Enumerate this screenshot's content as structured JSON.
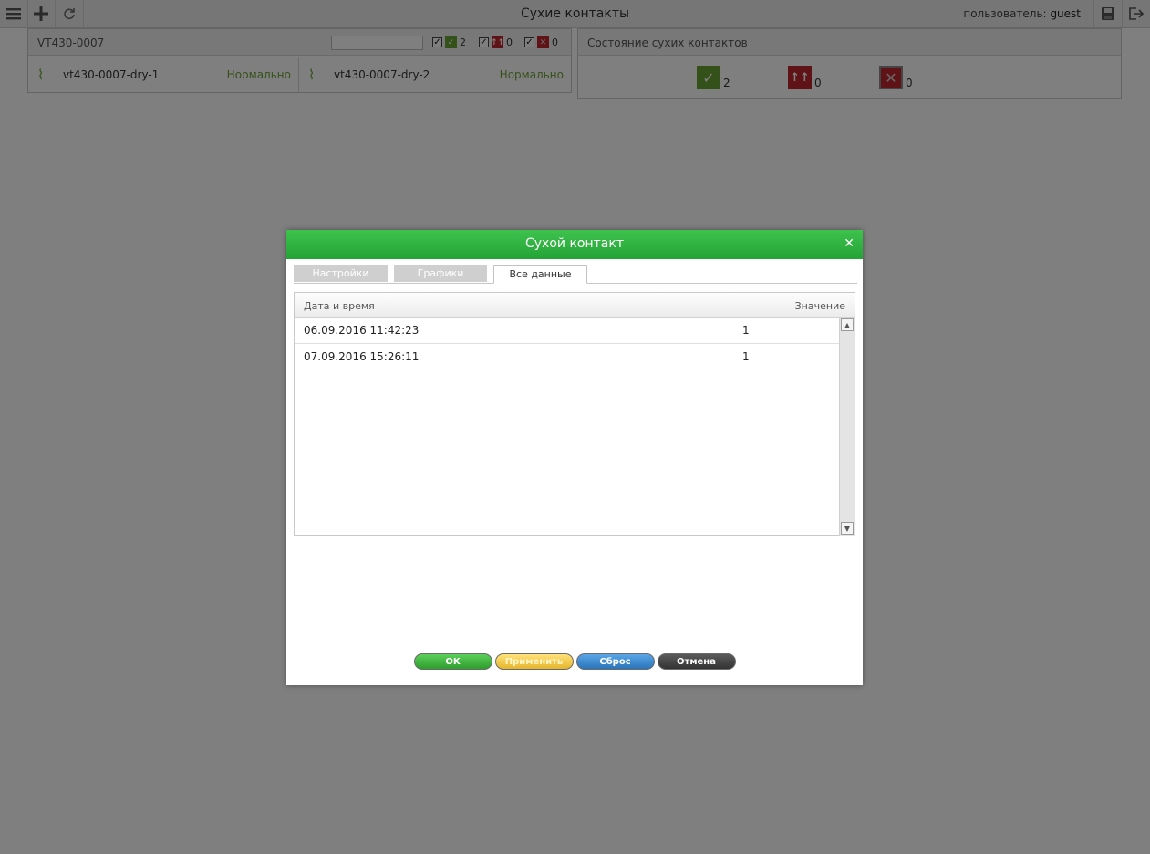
{
  "app": {
    "title": "Сухие контакты",
    "user_label": "пользователь:",
    "user_name": "guest"
  },
  "device_panel": {
    "title": "VT430-0007",
    "search_value": "",
    "filters": [
      {
        "checked": "✓",
        "icon": "ok",
        "count": "2"
      },
      {
        "checked": "✓",
        "icon": "up",
        "count": "0"
      },
      {
        "checked": "✓",
        "icon": "error",
        "count": "0"
      }
    ],
    "contacts": [
      {
        "name": "vt430-0007-dry-1",
        "status": "Нормально"
      },
      {
        "name": "vt430-0007-dry-2",
        "status": "Нормально"
      }
    ]
  },
  "status_panel": {
    "title": "Состояние сухих контактов",
    "stats": [
      {
        "icon": "ok",
        "count": "2"
      },
      {
        "icon": "up",
        "count": "0"
      },
      {
        "icon": "error",
        "count": "0"
      }
    ]
  },
  "dialog": {
    "title": "Сухой контакт",
    "close_symbol": "✕",
    "tabs": [
      {
        "label": "Настройки",
        "active": false
      },
      {
        "label": "Графики",
        "active": false
      },
      {
        "label": "Все данные",
        "active": true
      }
    ],
    "grid": {
      "columns": [
        "Дата и время",
        "Значение"
      ],
      "rows": [
        {
          "datetime": "06.09.2016 11:42:23",
          "value": "1"
        },
        {
          "datetime": "07.09.2016 15:26:11",
          "value": "1"
        }
      ]
    },
    "buttons": {
      "ok": "OK",
      "apply": "Применить",
      "reset": "Сброс",
      "cancel": "Отмена"
    }
  },
  "colors": {
    "accent_green": "#2db33e",
    "status_ok": "#6ba234",
    "status_alarm": "#c0272d"
  }
}
